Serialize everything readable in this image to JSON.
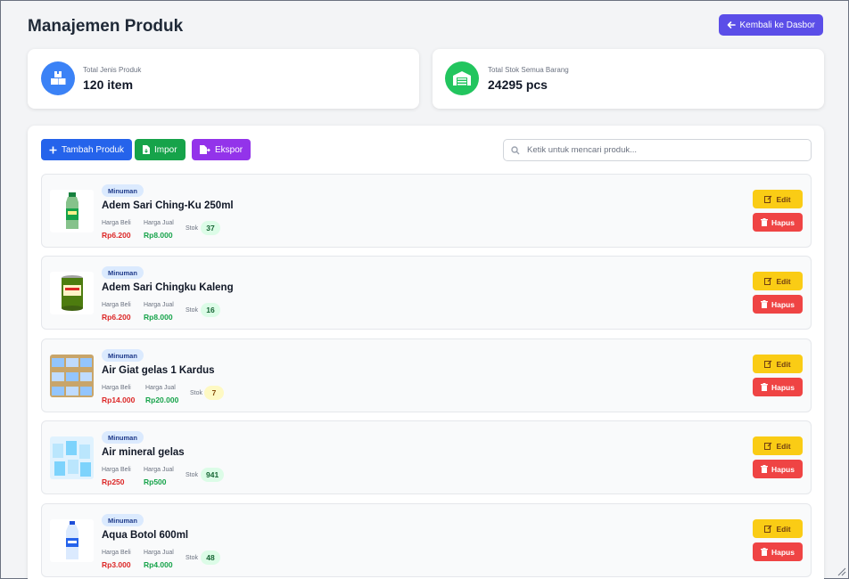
{
  "header": {
    "title": "Manajemen Produk",
    "back_label": "Kembali ke Dasbor"
  },
  "stats": [
    {
      "label": "Total Jenis Produk",
      "value": "120 item",
      "icon": "boxes-icon",
      "color": "#3b82f6"
    },
    {
      "label": "Total Stok Semua Barang",
      "value": "24295 pcs",
      "icon": "warehouse-icon",
      "color": "#22c55e"
    }
  ],
  "toolbar": {
    "add_label": "Tambah Produk",
    "import_label": "Impor",
    "export_label": "Ekspor",
    "search_placeholder": "Ketik untuk mencari produk..."
  },
  "labels": {
    "buy": "Harga Beli",
    "sell": "Harga Jual",
    "stock": "Stok",
    "edit": "Edit",
    "delete": "Hapus"
  },
  "products": [
    {
      "category": "Minuman",
      "name": "Adem Sari Ching-Ku 250ml",
      "buy": "Rp6.200",
      "sell": "Rp8.000",
      "stock": "37",
      "stock_status": "ok"
    },
    {
      "category": "Minuman",
      "name": "Adem Sari Chingku Kaleng",
      "buy": "Rp6.200",
      "sell": "Rp8.000",
      "stock": "16",
      "stock_status": "ok"
    },
    {
      "category": "Minuman",
      "name": "Air Giat gelas 1 Kardus",
      "buy": "Rp14.000",
      "sell": "Rp20.000",
      "stock": "7",
      "stock_status": "low"
    },
    {
      "category": "Minuman",
      "name": "Air mineral gelas",
      "buy": "Rp250",
      "sell": "Rp500",
      "stock": "941",
      "stock_status": "ok"
    },
    {
      "category": "Minuman",
      "name": "Aqua Botol 600ml",
      "buy": "Rp3.000",
      "sell": "Rp4.000",
      "stock": "48",
      "stock_status": "ok"
    }
  ],
  "colors": {
    "primary": "#2563eb",
    "back_button": "#5b4ee8",
    "import": "#16a34a",
    "export": "#9333ea",
    "edit": "#facc15",
    "delete": "#ef4444"
  }
}
